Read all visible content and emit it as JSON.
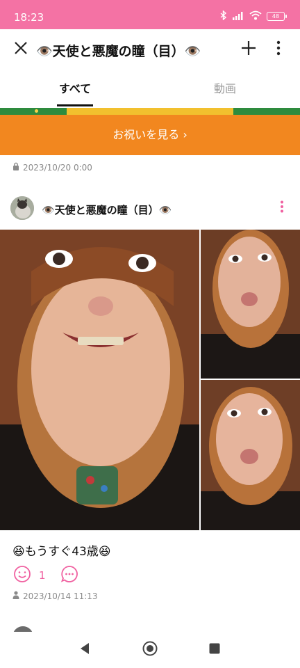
{
  "status_bar": {
    "time": "18:23",
    "battery": "48"
  },
  "header": {
    "title": "👁️天使と悪魔の瞳（目）👁️"
  },
  "tabs": [
    {
      "label": "すべて",
      "active": true
    },
    {
      "label": "動画",
      "active": false
    }
  ],
  "banner": {
    "button_label": "お祝いを見る ›"
  },
  "top_meta": {
    "date": "2023/10/20 0:00"
  },
  "post": {
    "author": "👁️天使と悪魔の瞳（目）👁️",
    "caption": "😆もうすぐ43歳😆",
    "like_count": "1",
    "date": "2023/10/14 11:13"
  },
  "colors": {
    "status_bar": "#f472a4",
    "banner_orange": "#f2871f",
    "accent_pink": "#f060a0"
  },
  "icons": [
    "bluetooth-icon",
    "signal-icon",
    "wifi-icon",
    "battery-icon",
    "close-icon",
    "plus-icon",
    "more-vertical-icon",
    "lock-icon",
    "smile-icon",
    "comment-icon",
    "person-icon",
    "back-icon",
    "home-icon",
    "recents-icon"
  ]
}
